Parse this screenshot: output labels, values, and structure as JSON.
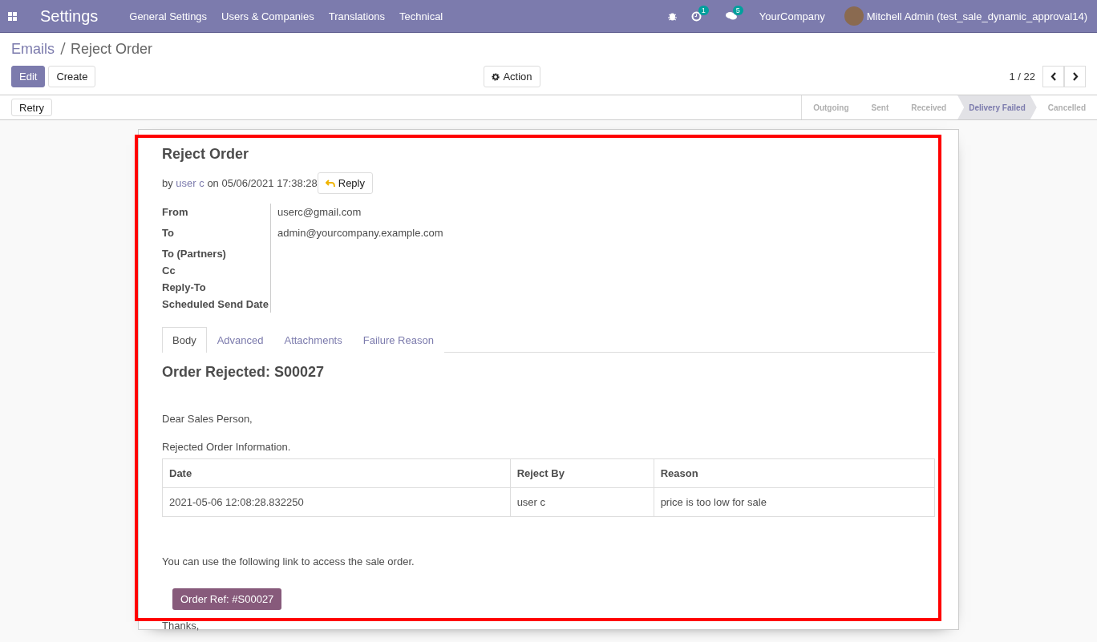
{
  "navbar": {
    "app_title": "Settings",
    "menu": [
      "General Settings",
      "Users & Companies",
      "Translations",
      "Technical"
    ],
    "activity_count": "1",
    "message_count": "5",
    "company": "YourCompany",
    "user": "Mitchell Admin (test_sale_dynamic_approval14)"
  },
  "breadcrumb": {
    "parent": "Emails",
    "current": "Reject Order"
  },
  "buttons": {
    "edit": "Edit",
    "create": "Create",
    "action": "Action",
    "retry": "Retry"
  },
  "pager": "1 / 22",
  "statusbar": [
    {
      "label": "Outgoing",
      "selected": false
    },
    {
      "label": "Sent",
      "selected": false
    },
    {
      "label": "Received",
      "selected": false
    },
    {
      "label": "Delivery Failed",
      "selected": true
    },
    {
      "label": "Cancelled",
      "selected": false
    }
  ],
  "mail": {
    "subject": "Reject Order",
    "by": "by",
    "author": "user c",
    "date": "on 05/06/2021 17:38:28",
    "reply": "Reply",
    "fields": [
      {
        "label": "From",
        "value": "userc@gmail.com"
      },
      {
        "label": "To",
        "value": "admin@yourcompany.example.com"
      },
      {
        "label": "To (Partners)"
      },
      {
        "label": "Cc"
      },
      {
        "label": "Reply-To"
      },
      {
        "label": "Scheduled Send Date"
      }
    ]
  },
  "tabs": [
    {
      "label": "Body",
      "selected": true
    },
    {
      "label": "Advanced",
      "selected": false
    },
    {
      "label": "Attachments",
      "selected": false
    },
    {
      "label": "Failure Reason",
      "selected": false
    }
  ],
  "body": {
    "heading": "Order Rejected: S00027",
    "greeting": "Dear Sales Person,",
    "intro": "Rejected Order Information.",
    "table": {
      "columns": [
        "Date",
        "Reject By",
        "Reason"
      ],
      "rows": [
        [
          "2021-05-06 12:08:28.832250",
          "user c",
          "price is too low for sale"
        ]
      ]
    },
    "link_text": "You can use the following link to access the sale order.",
    "order_button": "Order Ref: #S00027",
    "closing": "Thanks,"
  }
}
